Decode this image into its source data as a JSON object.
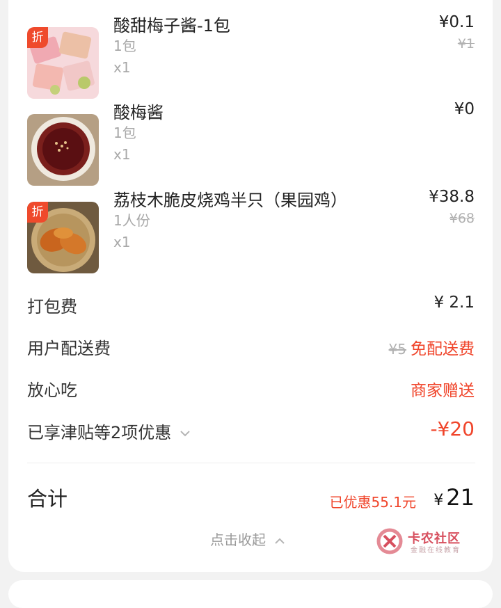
{
  "items": [
    {
      "name": "酸甜梅子酱-1包",
      "spec": "1包",
      "qty": "x1",
      "price": "¥0.1",
      "original_price": "¥1",
      "badge": "折"
    },
    {
      "name": "酸梅酱",
      "spec": "1包",
      "qty": "x1",
      "price": "¥0",
      "original_price": "",
      "badge": ""
    },
    {
      "name": "荔枝木脆皮烧鸡半只（果园鸡）",
      "spec": "1人份",
      "qty": "x1",
      "price": "¥38.8",
      "original_price": "¥68",
      "badge": "折"
    }
  ],
  "fees": {
    "packing_label": "打包费",
    "packing_value": "¥ 2.1",
    "delivery_label": "用户配送费",
    "delivery_original": "¥5",
    "delivery_value": "免配送费",
    "assured_label": "放心吃",
    "assured_value": "商家赠送",
    "discount_label": "已享津贴等2项优惠",
    "discount_value": "-¥20"
  },
  "summary": {
    "total_label": "合计",
    "saved_text": "已优惠55.1元",
    "total_currency": "¥",
    "total_value": "21",
    "collapse_text": "点击收起"
  },
  "watermark": {
    "title": "卡农社区",
    "subtitle": "金融在线教育"
  },
  "colors": {
    "accent_red": "#f0452b",
    "badge_red": "#ef4a2c"
  }
}
